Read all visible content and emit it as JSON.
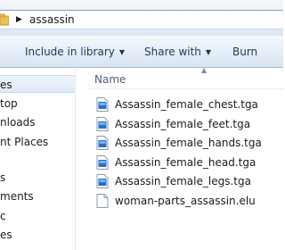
{
  "address": {
    "crumbs": [
      "assassin"
    ]
  },
  "toolbar": {
    "include_in_library": "Include in library",
    "share_with": "Share with",
    "burn": "Burn"
  },
  "nav": {
    "items": [
      {
        "label": "es",
        "selected": true
      },
      {
        "label": "top"
      },
      {
        "label": "nloads"
      },
      {
        "label": "nt Places"
      },
      {
        "label": "s"
      },
      {
        "label": "ments"
      },
      {
        "label": "c"
      },
      {
        "label": "es"
      }
    ]
  },
  "files": {
    "column_header": "Name",
    "items": [
      {
        "name": "Assassin_female_chest.tga",
        "icon": "tga-image-icon"
      },
      {
        "name": "Assassin_female_feet.tga",
        "icon": "tga-image-icon"
      },
      {
        "name": "Assassin_female_hands.tga",
        "icon": "tga-image-icon"
      },
      {
        "name": "Assassin_female_head.tga",
        "icon": "tga-image-icon"
      },
      {
        "name": "Assassin_female_legs.tga",
        "icon": "tga-image-icon"
      },
      {
        "name": "woman-parts_assassin.elu",
        "icon": "generic-file-icon"
      }
    ]
  },
  "colors": {
    "command_text": "#1e395b",
    "selection": "#dfeaf7",
    "folder": "#e8c15a",
    "image_icon": "#2f6fc0"
  }
}
